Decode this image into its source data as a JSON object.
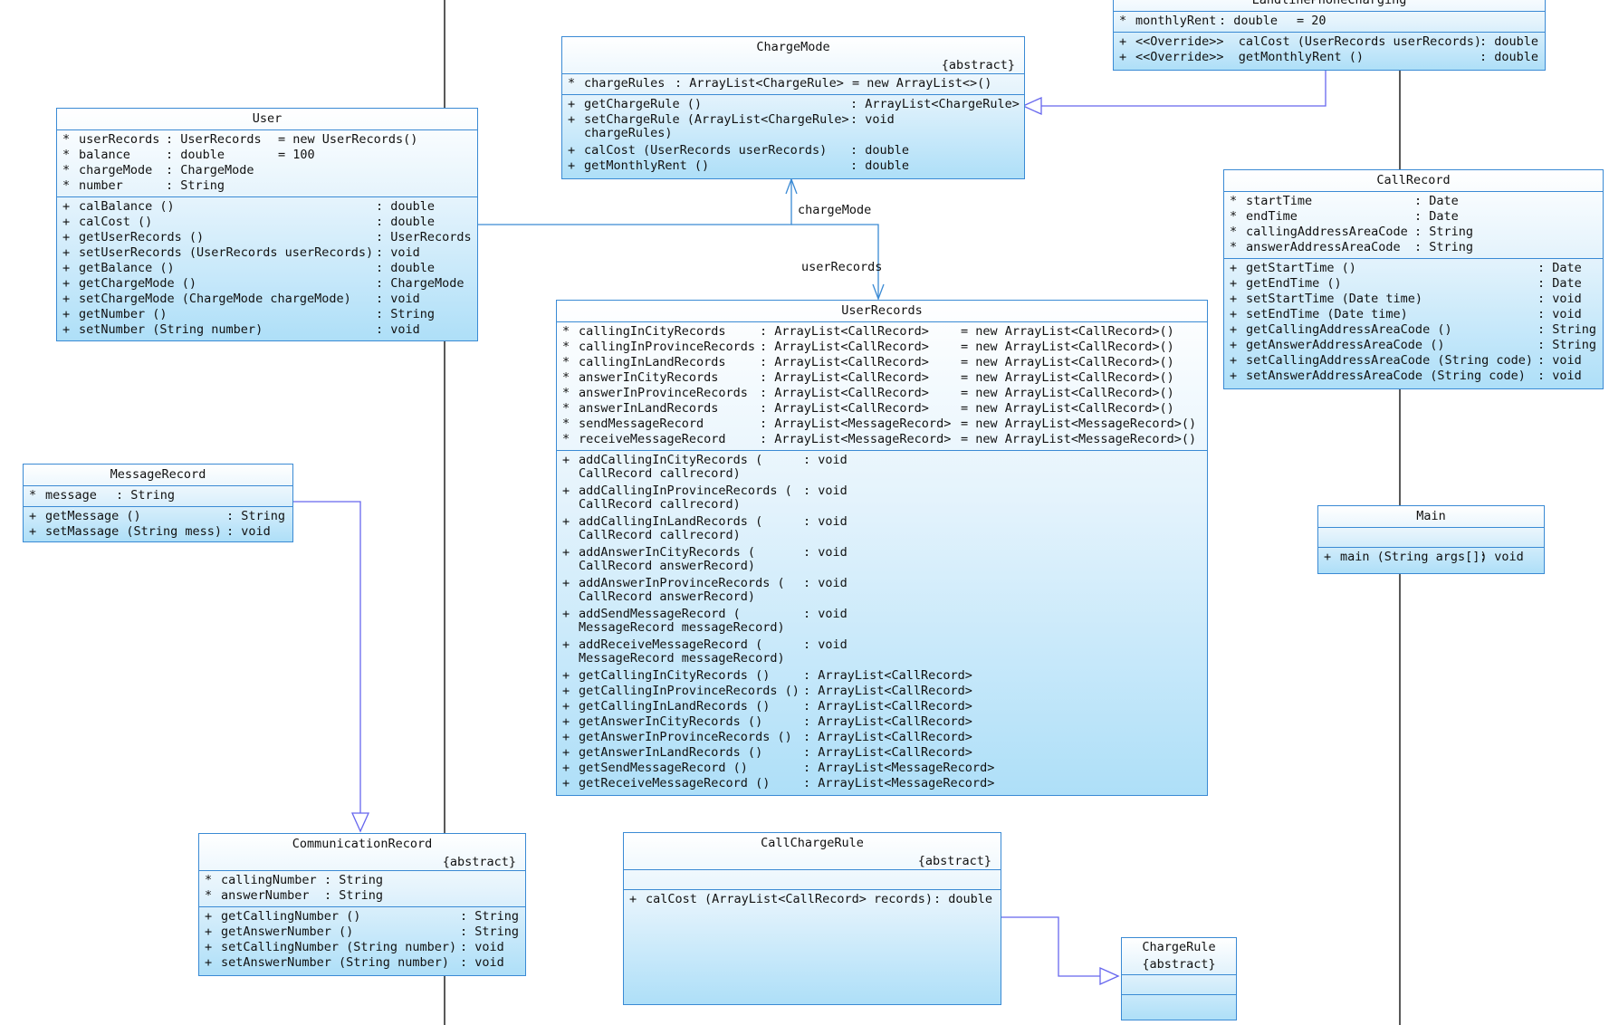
{
  "colors": {
    "box_border": "#3a8ad4",
    "box_fill_top": "#ffffff",
    "box_fill_bottom": "#aedff8",
    "connector": "#6666ee",
    "lifeline": "#222222"
  },
  "landline": {
    "name": "LandlinePhoneCharging",
    "attributes": [
      {
        "vis": "*",
        "name": "monthlyRent",
        "type": ": double",
        "init": "= 20"
      }
    ],
    "methods": [
      {
        "vis": "+",
        "name": "<<Override>>  calCost (UserRecords userRecords)",
        "ret": ": double"
      },
      {
        "vis": "+",
        "name": "<<Override>>  getMonthlyRent ()",
        "ret": ": double"
      }
    ]
  },
  "chargemode": {
    "name": "ChargeMode",
    "stereotype": "{abstract}",
    "attributes": [
      {
        "vis": "*",
        "name": "chargeRules",
        "type": ": ArrayList<ChargeRule>",
        "init": "= new ArrayList<>()"
      }
    ],
    "methods": [
      {
        "vis": "+",
        "name": "getChargeRule ()",
        "ret": ": ArrayList<ChargeRule>"
      },
      {
        "vis": "+",
        "name": "setChargeRule (ArrayList<ChargeRule>\nchargeRules)",
        "ret": ": void"
      },
      {
        "vis": "+",
        "name": "calCost (UserRecords userRecords)",
        "ret": ": double"
      },
      {
        "vis": "+",
        "name": "getMonthlyRent ()",
        "ret": ": double"
      }
    ]
  },
  "user": {
    "name": "User",
    "attributes": [
      {
        "vis": "*",
        "name": "userRecords",
        "type": ": UserRecords",
        "init": "= new UserRecords()"
      },
      {
        "vis": "*",
        "name": "balance",
        "type": ": double",
        "init": "= 100"
      },
      {
        "vis": "*",
        "name": "chargeMode",
        "type": ": ChargeMode",
        "init": ""
      },
      {
        "vis": "*",
        "name": "number",
        "type": ": String",
        "init": ""
      }
    ],
    "methods": [
      {
        "vis": "+",
        "name": "calBalance ()",
        "ret": ": double"
      },
      {
        "vis": "+",
        "name": "calCost ()",
        "ret": ": double"
      },
      {
        "vis": "+",
        "name": "getUserRecords ()",
        "ret": ": UserRecords"
      },
      {
        "vis": "+",
        "name": "setUserRecords (UserRecords userRecords)",
        "ret": ": void"
      },
      {
        "vis": "+",
        "name": "getBalance ()",
        "ret": ": double"
      },
      {
        "vis": "+",
        "name": "getChargeMode ()",
        "ret": ": ChargeMode"
      },
      {
        "vis": "+",
        "name": "setChargeMode (ChargeMode chargeMode)",
        "ret": ": void"
      },
      {
        "vis": "+",
        "name": "getNumber ()",
        "ret": ": String"
      },
      {
        "vis": "+",
        "name": "setNumber (String number)",
        "ret": ": void"
      }
    ]
  },
  "callrecord": {
    "name": "CallRecord",
    "attributes": [
      {
        "vis": "*",
        "name": "startTime",
        "type": ": Date"
      },
      {
        "vis": "*",
        "name": "endTime",
        "type": ": Date"
      },
      {
        "vis": "*",
        "name": "callingAddressAreaCode",
        "type": ": String"
      },
      {
        "vis": "*",
        "name": "answerAddressAreaCode",
        "type": ": String"
      }
    ],
    "methods": [
      {
        "vis": "+",
        "name": "getStartTime ()",
        "ret": ": Date"
      },
      {
        "vis": "+",
        "name": "getEndTime ()",
        "ret": ": Date"
      },
      {
        "vis": "+",
        "name": "setStartTime (Date time)",
        "ret": ": void"
      },
      {
        "vis": "+",
        "name": "setEndTime (Date time)",
        "ret": ": void"
      },
      {
        "vis": "+",
        "name": "getCallingAddressAreaCode ()",
        "ret": ": String"
      },
      {
        "vis": "+",
        "name": "getAnswerAddressAreaCode ()",
        "ret": ": String"
      },
      {
        "vis": "+",
        "name": "setCallingAddressAreaCode (String code)",
        "ret": ": void"
      },
      {
        "vis": "+",
        "name": "setAnswerAddressAreaCode (String code)",
        "ret": ": void"
      }
    ]
  },
  "userrecords": {
    "name": "UserRecords",
    "attributes": [
      {
        "vis": "*",
        "name": "callingInCityRecords",
        "type": ": ArrayList<CallRecord>",
        "init": "= new ArrayList<CallRecord>()"
      },
      {
        "vis": "*",
        "name": "callingInProvinceRecords",
        "type": ": ArrayList<CallRecord>",
        "init": "= new ArrayList<CallRecord>()"
      },
      {
        "vis": "*",
        "name": "callingInLandRecords",
        "type": ": ArrayList<CallRecord>",
        "init": "= new ArrayList<CallRecord>()"
      },
      {
        "vis": "*",
        "name": "answerInCityRecords",
        "type": ": ArrayList<CallRecord>",
        "init": "= new ArrayList<CallRecord>()"
      },
      {
        "vis": "*",
        "name": "answerInProvinceRecords",
        "type": ": ArrayList<CallRecord>",
        "init": "= new ArrayList<CallRecord>()"
      },
      {
        "vis": "*",
        "name": "answerInLandRecords",
        "type": ": ArrayList<CallRecord>",
        "init": "= new ArrayList<CallRecord>()"
      },
      {
        "vis": "*",
        "name": "sendMessageRecord",
        "type": ": ArrayList<MessageRecord>",
        "init": "= new ArrayList<MessageRecord>()"
      },
      {
        "vis": "*",
        "name": "receiveMessageRecord",
        "type": ": ArrayList<MessageRecord>",
        "init": "= new ArrayList<MessageRecord>()"
      }
    ],
    "add_methods": [
      {
        "vis": "+",
        "name": "addCallingInCityRecords (\nCallRecord callrecord)",
        "ret": ": void"
      },
      {
        "vis": "+",
        "name": "addCallingInProvinceRecords (\nCallRecord callrecord)",
        "ret": ": void"
      },
      {
        "vis": "+",
        "name": "addCallingInLandRecords (\nCallRecord callrecord)",
        "ret": ": void"
      },
      {
        "vis": "+",
        "name": "addAnswerInCityRecords (\nCallRecord answerRecord)",
        "ret": ": void"
      },
      {
        "vis": "+",
        "name": "addAnswerInProvinceRecords (\nCallRecord answerRecord)",
        "ret": ": void"
      },
      {
        "vis": "+",
        "name": "addSendMessageRecord (\nMessageRecord messageRecord)",
        "ret": ": void"
      },
      {
        "vis": "+",
        "name": "addReceiveMessageRecord (\nMessageRecord messageRecord)",
        "ret": ": void"
      }
    ],
    "get_methods": [
      {
        "vis": "+",
        "name": "getCallingInCityRecords ()",
        "ret": ": ArrayList<CallRecord>"
      },
      {
        "vis": "+",
        "name": "getCallingInProvinceRecords ()",
        "ret": ": ArrayList<CallRecord>"
      },
      {
        "vis": "+",
        "name": "getCallingInLandRecords ()",
        "ret": ": ArrayList<CallRecord>"
      },
      {
        "vis": "+",
        "name": "getAnswerInCityRecords ()",
        "ret": ": ArrayList<CallRecord>"
      },
      {
        "vis": "+",
        "name": "getAnswerInProvinceRecords ()",
        "ret": ": ArrayList<CallRecord>"
      },
      {
        "vis": "+",
        "name": "getAnswerInLandRecords ()",
        "ret": ": ArrayList<CallRecord>"
      },
      {
        "vis": "+",
        "name": "getSendMessageRecord ()",
        "ret": ": ArrayList<MessageRecord>"
      },
      {
        "vis": "+",
        "name": "getReceiveMessageRecord ()",
        "ret": ": ArrayList<MessageRecord>"
      }
    ]
  },
  "messagerecord": {
    "name": "MessageRecord",
    "attributes": [
      {
        "vis": "*",
        "name": "message",
        "type": ": String"
      }
    ],
    "methods": [
      {
        "vis": "+",
        "name": "getMessage ()",
        "ret": ": String"
      },
      {
        "vis": "+",
        "name": "setMassage (String mess)",
        "ret": ": void"
      }
    ]
  },
  "main": {
    "name": "Main",
    "methods": [
      {
        "vis": "+",
        "name": "main (String args[])",
        "ret": ": void"
      }
    ]
  },
  "commrecord": {
    "name": "CommunicationRecord",
    "stereotype": "{abstract}",
    "attributes": [
      {
        "vis": "*",
        "name": "callingNumber",
        "type": ": String"
      },
      {
        "vis": "*",
        "name": "answerNumber",
        "type": ": String"
      }
    ],
    "methods": [
      {
        "vis": "+",
        "name": "getCallingNumber ()",
        "ret": ": String"
      },
      {
        "vis": "+",
        "name": "getAnswerNumber ()",
        "ret": ": String"
      },
      {
        "vis": "+",
        "name": "setCallingNumber (String number)",
        "ret": ": void"
      },
      {
        "vis": "+",
        "name": "setAnswerNumber (String number)",
        "ret": ": void"
      }
    ]
  },
  "callchargerule": {
    "name": "CallChargeRule",
    "stereotype": "{abstract}",
    "methods": [
      {
        "vis": "+",
        "name": "calCost (ArrayList<CallRecord> records)",
        "ret": ": double"
      }
    ]
  },
  "chargerule": {
    "name": "ChargeRule",
    "stereotype": "{abstract}"
  },
  "labels": {
    "chargeMode": "chargeMode",
    "userRecords": "userRecords"
  }
}
